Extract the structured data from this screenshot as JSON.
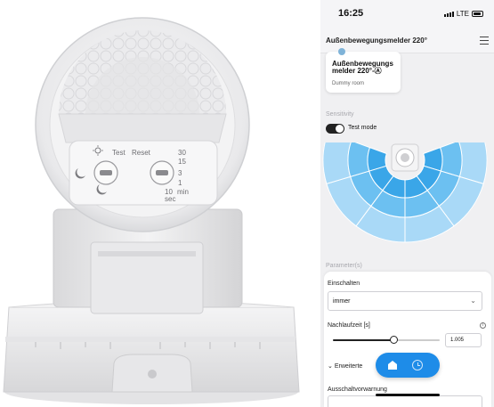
{
  "product_photo": {
    "dial_left": {
      "top_label": "Test",
      "symbols": [
        "sun-icon",
        "moon-icon"
      ]
    },
    "dial_right": {
      "reset_label": "Reset",
      "marks": [
        "30",
        "15",
        "3",
        "1",
        "10",
        "min",
        "sec"
      ]
    }
  },
  "status_bar": {
    "time": "16:25",
    "network": "LTE"
  },
  "app": {
    "title": "Außenbewegungsmelder 220°",
    "menu_icon": "hamburger-icon"
  },
  "device_card": {
    "name_line1": "Außenbewegungs",
    "name_line2": "melder 220°-Ⓐ",
    "room": "Dummy room",
    "icon": "bulb-icon"
  },
  "sensitivity": {
    "section_label": "Sensitivity",
    "test_mode_label": "Test mode",
    "test_mode_on": true
  },
  "detection_zone": {
    "arc_degrees": 220,
    "colors": {
      "outer": "#a9d9f7",
      "middle": "#6cc0f1",
      "inner": "#3aa6e8",
      "stroke": "#ffffff"
    }
  },
  "parameters": {
    "section_label": "Parameter(s)",
    "switch_on_label": "Einschalten",
    "switch_on_value": "immer",
    "follow_up_label": "Nachlaufzeit [s]",
    "follow_up_value": "1.005",
    "follow_up_fraction": 0.57,
    "advanced_label": "Erweiterte",
    "prewarn_label": "Ausschaltvorwarnung"
  },
  "fab": {
    "color": "#1e8ce8",
    "left_icon": "home-icon",
    "right_icon": "clock-icon"
  }
}
